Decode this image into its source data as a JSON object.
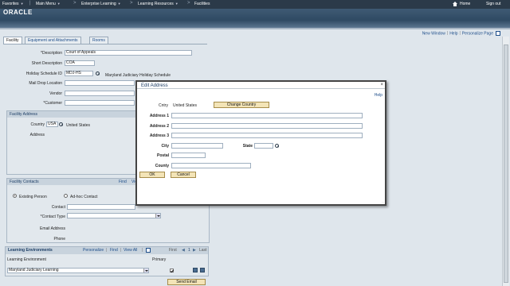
{
  "nav": {
    "favorites": "Favorites",
    "main_menu": "Main Menu",
    "enterprise_learning": "Enterprise Learning",
    "learning_resources": "Learning Resources",
    "facilities": "Facilities",
    "home": "Home",
    "sign_out": "Sign out"
  },
  "brand": {
    "logo": "ORACLE"
  },
  "toplinks": {
    "new_window": "New Window",
    "help": "Help",
    "personalize": "Personalize Page"
  },
  "tabs": {
    "facility": "Facility",
    "equipment": "Equipment and Attachments",
    "rooms": "Rooms"
  },
  "form": {
    "description_label": "*Description",
    "description_value": "Court of Appeals",
    "short_description_label": "Short Description",
    "short_description_value": "COA",
    "holiday_label": "Holiday Schedule ID",
    "holiday_value": "MDJ-HS",
    "holiday_desc": "Maryland Judiciary Holiday Schedule",
    "mail_drop_label": "Mail Drop Location",
    "vendor_label": "Vendor",
    "customer_label": "*Customer"
  },
  "facility_address": {
    "title": "Facility Address",
    "country_label": "Country",
    "country_value": "USA",
    "country_desc": "United States",
    "address_label": "Address"
  },
  "facility_contacts": {
    "title": "Facility Contacts",
    "find": "Find",
    "view": "Vie",
    "existing_person": "Existing Person",
    "adhoc_contact": "Ad-hoc Contact",
    "contact_label": "Contact",
    "contact_type_label": "*Contact Type",
    "email_label": "Email Address",
    "phone_label": "Phone"
  },
  "learning_env": {
    "title": "Learning Environments",
    "personalize": "Personalize",
    "find": "Find",
    "view_all": "View All",
    "first": "First",
    "pager": "1",
    "last": "Last",
    "col_env": "Learning Environment",
    "col_primary": "Primary",
    "row_value": "Maryland Judiciary Learning",
    "primary_checked": true
  },
  "send_email": "Send Email",
  "modal": {
    "title": "Edit Address",
    "close": "×",
    "help": "Help",
    "country_label": "Cntry",
    "country_value": "United States",
    "change_country": "Change Country",
    "address1": "Address 1",
    "address2": "Address 2",
    "address3": "Address 3",
    "city": "City",
    "state": "State",
    "postal": "Postal",
    "county": "County",
    "ok": "OK",
    "cancel": "Cancel",
    "resize_grip": "..."
  }
}
